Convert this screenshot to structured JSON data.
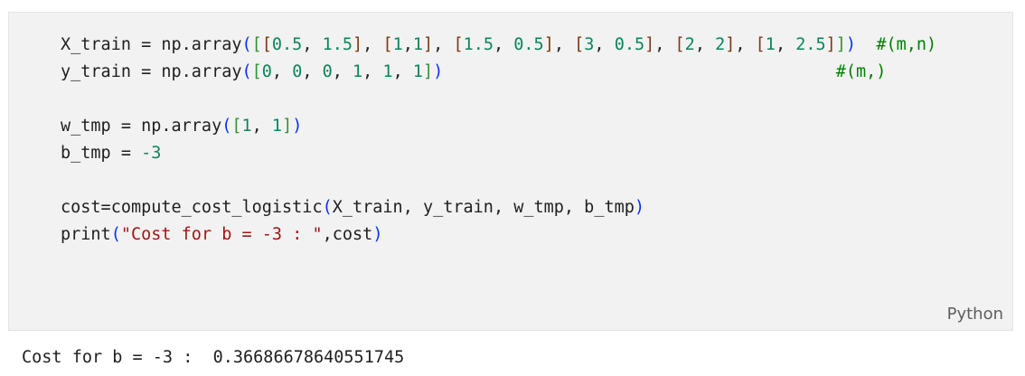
{
  "cell": {
    "language": "Python",
    "lines": [
      [
        {
          "t": "X_train = np.array",
          "c": ""
        },
        {
          "t": "(",
          "c": "b1"
        },
        {
          "t": "[",
          "c": "b2"
        },
        {
          "t": "[",
          "c": "b3"
        },
        {
          "t": "0.5",
          "c": "num"
        },
        {
          "t": ", ",
          "c": ""
        },
        {
          "t": "1.5",
          "c": "num"
        },
        {
          "t": "]",
          "c": "b3"
        },
        {
          "t": ", ",
          "c": ""
        },
        {
          "t": "[",
          "c": "b3"
        },
        {
          "t": "1",
          "c": "num"
        },
        {
          "t": ",",
          "c": ""
        },
        {
          "t": "1",
          "c": "num"
        },
        {
          "t": "]",
          "c": "b3"
        },
        {
          "t": ", ",
          "c": ""
        },
        {
          "t": "[",
          "c": "b3"
        },
        {
          "t": "1.5",
          "c": "num"
        },
        {
          "t": ", ",
          "c": ""
        },
        {
          "t": "0.5",
          "c": "num"
        },
        {
          "t": "]",
          "c": "b3"
        },
        {
          "t": ", ",
          "c": ""
        },
        {
          "t": "[",
          "c": "b3"
        },
        {
          "t": "3",
          "c": "num"
        },
        {
          "t": ", ",
          "c": ""
        },
        {
          "t": "0.5",
          "c": "num"
        },
        {
          "t": "]",
          "c": "b3"
        },
        {
          "t": ", ",
          "c": ""
        },
        {
          "t": "[",
          "c": "b3"
        },
        {
          "t": "2",
          "c": "num"
        },
        {
          "t": ", ",
          "c": ""
        },
        {
          "t": "2",
          "c": "num"
        },
        {
          "t": "]",
          "c": "b3"
        },
        {
          "t": ", ",
          "c": ""
        },
        {
          "t": "[",
          "c": "b3"
        },
        {
          "t": "1",
          "c": "num"
        },
        {
          "t": ", ",
          "c": ""
        },
        {
          "t": "2.5",
          "c": "num"
        },
        {
          "t": "]",
          "c": "b3"
        },
        {
          "t": "]",
          "c": "b2"
        },
        {
          "t": ")",
          "c": "b1"
        },
        {
          "t": "  ",
          "c": ""
        },
        {
          "t": "#(m,n)",
          "c": "com"
        }
      ],
      [
        {
          "t": "y_train = np.array",
          "c": ""
        },
        {
          "t": "(",
          "c": "b1"
        },
        {
          "t": "[",
          "c": "b2"
        },
        {
          "t": "0",
          "c": "num"
        },
        {
          "t": ", ",
          "c": ""
        },
        {
          "t": "0",
          "c": "num"
        },
        {
          "t": ", ",
          "c": ""
        },
        {
          "t": "0",
          "c": "num"
        },
        {
          "t": ", ",
          "c": ""
        },
        {
          "t": "1",
          "c": "num"
        },
        {
          "t": ", ",
          "c": ""
        },
        {
          "t": "1",
          "c": "num"
        },
        {
          "t": ", ",
          "c": ""
        },
        {
          "t": "1",
          "c": "num"
        },
        {
          "t": "]",
          "c": "b2"
        },
        {
          "t": ")",
          "c": "b1"
        },
        {
          "t": "                                       ",
          "c": ""
        },
        {
          "t": "#(m,)",
          "c": "com"
        }
      ],
      [],
      [
        {
          "t": "w_tmp = np.array",
          "c": ""
        },
        {
          "t": "(",
          "c": "b1"
        },
        {
          "t": "[",
          "c": "b2"
        },
        {
          "t": "1",
          "c": "num"
        },
        {
          "t": ", ",
          "c": ""
        },
        {
          "t": "1",
          "c": "num"
        },
        {
          "t": "]",
          "c": "b2"
        },
        {
          "t": ")",
          "c": "b1"
        }
      ],
      [
        {
          "t": "b_tmp = ",
          "c": ""
        },
        {
          "t": "-3",
          "c": "num"
        }
      ],
      [],
      [
        {
          "t": "cost=compute_cost_logistic",
          "c": ""
        },
        {
          "t": "(",
          "c": "b1"
        },
        {
          "t": "X_train, y_train, w_tmp, b_tmp",
          "c": ""
        },
        {
          "t": ")",
          "c": "b1"
        }
      ],
      [
        {
          "t": "print",
          "c": ""
        },
        {
          "t": "(",
          "c": "b1"
        },
        {
          "t": "\"Cost for b = -3 : \"",
          "c": "str"
        },
        {
          "t": ",cost",
          "c": ""
        },
        {
          "t": ")",
          "c": "b1"
        }
      ]
    ]
  },
  "output": {
    "text": "Cost for b = -3 :  0.36686678640551745"
  }
}
